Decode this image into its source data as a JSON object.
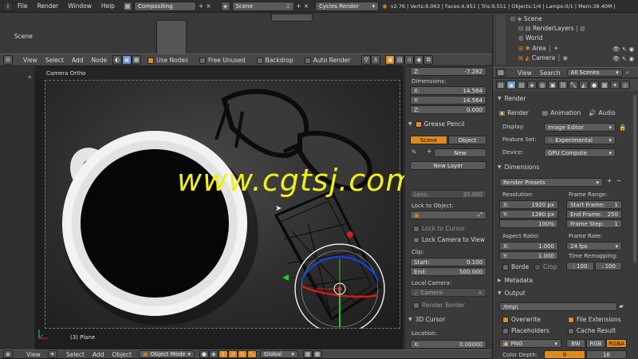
{
  "topbar": {
    "menus": [
      "File",
      "Render",
      "Window",
      "Help"
    ],
    "screen_layout": "Compositing",
    "scene": "Scene",
    "scene_number": "2",
    "engine": "Cycles Render",
    "stats": "v2.76 | Verts:8,063 | Faces:4,951 | Tris:9,551 | Objects:1/4 | Lamps:0/1 | Mem:38.40M |"
  },
  "upper_area": {
    "label": "Scene"
  },
  "node_header": {
    "menus": [
      "View",
      "Select",
      "Add",
      "Node"
    ],
    "use_nodes": "Use Nodes",
    "free_unused": "Free Unused",
    "backdrop": "Backdrop",
    "auto_render": "Auto Render"
  },
  "outliner": {
    "items": [
      "Scene",
      "RenderLayers",
      "World",
      "Area",
      "Camera"
    ]
  },
  "viewport": {
    "mode_label": "Camera Ortho",
    "object_label": "(3) Plane",
    "watermark": "www.cgtsj.com"
  },
  "bottom_bar": {
    "menus": [
      "View",
      "Select",
      "Add",
      "Object"
    ],
    "mode": "Object Mode",
    "pivot": "Global"
  },
  "n_panel": {
    "z_top": {
      "label": "Z:",
      "value": "-7.282"
    },
    "dimensions": {
      "title": "Dimensions:",
      "x": {
        "label": "X:",
        "value": "14.564"
      },
      "y": {
        "label": "Y:",
        "value": "14.564"
      },
      "z": {
        "label": "Z:",
        "value": "0.000"
      }
    },
    "grease_pencil": {
      "title": "Grease Pencil",
      "tab_scene": "Scene",
      "tab_object": "Object",
      "new": "New",
      "new_layer": "New Layer"
    },
    "lens": {
      "label": "Lens:",
      "value": "35.000"
    },
    "lock_to_object": "Lock to Object:",
    "lock_to_cursor": "Lock to Cursor",
    "lock_camera_to_view": "Lock Camera to View",
    "clip": {
      "title": "Clip:",
      "start": {
        "label": "Start:",
        "value": "0.100"
      },
      "end": {
        "label": "End:",
        "value": "500.000"
      }
    },
    "local_camera": {
      "title": "Local Camera:",
      "value": "Camera"
    },
    "render_border": "Render Border",
    "cursor": {
      "title": "3D Cursor",
      "location": "Location:",
      "x": {
        "label": "X:",
        "value": "0.00000"
      }
    }
  },
  "properties": {
    "header": {
      "view": "View",
      "search": "Search",
      "filter": "All Scenes"
    },
    "render": {
      "title": "Render",
      "btn_render": "Render",
      "btn_animation": "Animation",
      "btn_audio": "Audio",
      "display_label": "Display:",
      "display_value": "Image Editor",
      "feature_label": "Feature Set:",
      "feature_value": "Experimental",
      "device_label": "Device:",
      "device_value": "GPU Compute"
    },
    "dimensions": {
      "title": "Dimensions",
      "presets": "Render Presets",
      "resolution": "Resolution:",
      "res_x": {
        "label": "X:",
        "value": "1920 px"
      },
      "res_y": {
        "label": "Y:",
        "value": "1280 px"
      },
      "res_pct": "100%",
      "frame_range": "Frame Range:",
      "start_frame": {
        "label": "Start Frame:",
        "value": "1"
      },
      "end_frame": {
        "label": "End Frame:",
        "value": "250"
      },
      "frame_step": {
        "label": "Frame Step:",
        "value": "1"
      },
      "aspect": "Aspect Ratio:",
      "asp_x": {
        "label": "X:",
        "value": "1.000"
      },
      "asp_y": {
        "label": "Y:",
        "value": "1.000"
      },
      "frame_rate": "Frame Rate:",
      "fps": "24 fps",
      "time_remap": "Time Remapping:",
      "remap_old": ": 100",
      "remap_new": ": 100",
      "border": "Borde",
      "crop": "Crop"
    },
    "metadata": {
      "title": "Metadata"
    },
    "output": {
      "title": "Output",
      "path": "/tmp\\",
      "overwrite": "Overwrite",
      "file_extensions": "File Extensions",
      "placeholders": "Placeholders",
      "cache_result": "Cache Result",
      "format": "PNG",
      "bw": "BW",
      "rgb": "RGB",
      "rgba": "RGBA",
      "color_depth": "Color Depth:",
      "depth_8": "8",
      "depth_16": "16"
    }
  },
  "colors": {
    "accent": "#e08a1e",
    "watermark": "#f2ee1a",
    "panel": "#3a3a3a",
    "header": "#474747"
  }
}
